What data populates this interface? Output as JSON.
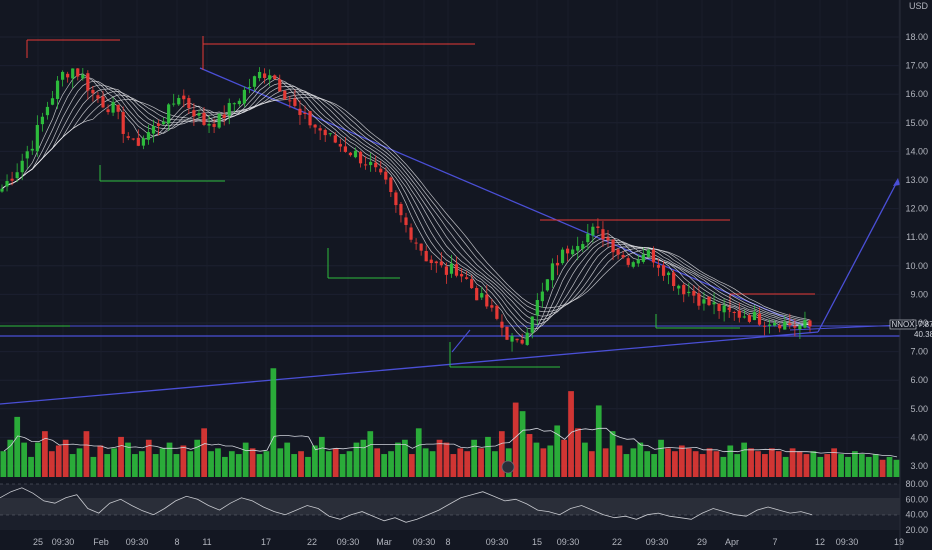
{
  "chart_data": {
    "type": "candlestick",
    "currency": "USD",
    "symbol": "NNOX",
    "price_axis": {
      "ylim": [
        5.0,
        18.5
      ],
      "ticks": [
        "18.00",
        "17.00",
        "16.00",
        "15.00",
        "14.00",
        "13.00",
        "12.00",
        "11.00",
        "10.00",
        "9.00",
        "8.00",
        "7.00",
        "6.00",
        "5.00",
        "4.00",
        "3.00"
      ]
    },
    "rsi_axis": {
      "ylim": [
        20,
        80
      ],
      "ticks": [
        "80.00",
        "60.00",
        "40.00",
        "20.00"
      ]
    },
    "x_ticks": [
      "25",
      "09:30",
      "Feb",
      "09:30",
      "8",
      "11",
      "17",
      "22",
      "09:30",
      "Mar",
      "09:30",
      "8",
      "09:30",
      "15",
      "09:30",
      "22",
      "09:30",
      "29",
      "Apr",
      "7",
      "12",
      "09:30",
      "19"
    ],
    "last_price": "7.87",
    "last_price_secondary": "40.38",
    "close_path": [
      [
        0,
        12.7
      ],
      [
        3,
        13.4
      ],
      [
        6,
        14.3
      ],
      [
        9,
        15.6
      ],
      [
        12,
        16.7
      ],
      [
        14,
        16.9
      ],
      [
        16,
        16.6
      ],
      [
        18,
        16.0
      ],
      [
        20,
        15.7
      ],
      [
        22,
        15.5
      ],
      [
        24,
        14.8
      ],
      [
        26,
        14.2
      ],
      [
        28,
        14.5
      ],
      [
        30,
        14.8
      ],
      [
        33,
        15.4
      ],
      [
        35,
        16.0
      ],
      [
        38,
        15.4
      ],
      [
        40,
        15.0
      ],
      [
        43,
        15.1
      ],
      [
        46,
        15.7
      ],
      [
        49,
        16.3
      ],
      [
        51,
        16.7
      ],
      [
        53,
        16.8
      ],
      [
        55,
        16.3
      ],
      [
        57,
        15.8
      ],
      [
        59,
        15.2
      ],
      [
        61,
        15.0
      ],
      [
        64,
        14.6
      ],
      [
        67,
        14.2
      ],
      [
        70,
        13.9
      ],
      [
        73,
        13.5
      ],
      [
        76,
        12.8
      ],
      [
        78,
        12.0
      ],
      [
        80,
        11.4
      ],
      [
        82,
        10.9
      ],
      [
        84,
        10.3
      ],
      [
        86,
        10.0
      ],
      [
        88,
        9.8
      ],
      [
        90,
        9.9
      ],
      [
        92,
        9.5
      ],
      [
        94,
        9.0
      ],
      [
        96,
        8.6
      ],
      [
        98,
        8.1
      ],
      [
        100,
        7.6
      ],
      [
        102,
        7.2
      ],
      [
        103,
        7.4
      ],
      [
        105,
        8.4
      ],
      [
        107,
        9.0
      ],
      [
        109,
        9.9
      ],
      [
        111,
        10.4
      ],
      [
        113,
        10.8
      ],
      [
        115,
        11.0
      ],
      [
        117,
        11.2
      ],
      [
        119,
        11.1
      ],
      [
        121,
        10.7
      ],
      [
        123,
        10.3
      ],
      [
        125,
        10.2
      ],
      [
        127,
        10.5
      ],
      [
        129,
        10.3
      ],
      [
        131,
        9.9
      ],
      [
        133,
        9.5
      ],
      [
        135,
        9.2
      ],
      [
        137,
        9.0
      ],
      [
        139,
        8.7
      ],
      [
        141,
        8.6
      ],
      [
        143,
        8.4
      ],
      [
        145,
        8.3
      ],
      [
        147,
        8.3
      ],
      [
        149,
        8.2
      ],
      [
        151,
        8.1
      ],
      [
        153,
        8.1
      ],
      [
        155,
        8.0
      ],
      [
        157,
        7.9
      ],
      [
        159,
        7.9
      ],
      [
        160,
        7.87
      ]
    ],
    "volume": [
      3.5,
      3.9,
      4.7,
      3.8,
      3.3,
      3.8,
      4.2,
      3.5,
      3.7,
      3.9,
      3.4,
      3.6,
      4.2,
      3.3,
      3.7,
      3.4,
      3.6,
      4.0,
      3.8,
      3.4,
      3.5,
      3.9,
      3.4,
      3.6,
      3.8,
      3.4,
      3.7,
      3.5,
      3.9,
      4.3,
      3.5,
      3.6,
      3.3,
      3.5,
      3.4,
      3.8,
      3.6,
      3.4,
      3.5,
      6.4,
      3.6,
      3.8,
      3.4,
      3.5,
      3.3,
      3.7,
      4.0,
      3.5,
      3.6,
      3.4,
      3.5,
      3.8,
      3.9,
      4.2,
      3.6,
      3.4,
      3.5,
      3.8,
      3.9,
      3.4,
      4.3,
      3.6,
      3.5,
      3.9,
      3.8,
      3.4,
      3.6,
      3.5,
      3.9,
      3.6,
      4.0,
      3.5,
      4.2,
      3.6,
      5.2,
      4.9,
      4.1,
      3.8,
      3.6,
      3.7,
      4.4,
      3.9,
      5.6,
      4.3,
      3.8,
      3.5,
      5.1,
      3.6,
      4.2,
      3.7,
      3.4,
      3.6,
      3.8,
      3.5,
      3.4,
      3.9,
      3.6,
      3.5,
      3.7,
      3.6,
      3.5,
      3.4,
      3.6,
      3.5,
      3.3,
      3.7,
      3.4,
      3.8,
      3.6,
      3.5,
      3.4,
      3.6,
      3.5,
      3.3,
      3.6,
      3.5,
      3.4,
      3.5,
      3.3,
      3.4,
      3.6,
      3.4,
      3.3,
      3.5,
      3.4,
      3.3,
      3.4,
      3.2,
      3.3,
      3.2
    ],
    "rsi": [
      62,
      70,
      75,
      68,
      58,
      55,
      62,
      66,
      48,
      42,
      55,
      60,
      52,
      45,
      40,
      48,
      58,
      64,
      60,
      52,
      46,
      55,
      62,
      58,
      50,
      44,
      40,
      46,
      52,
      48,
      38,
      34,
      40,
      44,
      38,
      32,
      36,
      30,
      34,
      40,
      46,
      54,
      62,
      66,
      70,
      64,
      58,
      60,
      54,
      46,
      44,
      40,
      48,
      52,
      46,
      40,
      36,
      38,
      34,
      40,
      42,
      38,
      36,
      34,
      42,
      48,
      44,
      40,
      38,
      46,
      50,
      46,
      42,
      44,
      40
    ]
  }
}
